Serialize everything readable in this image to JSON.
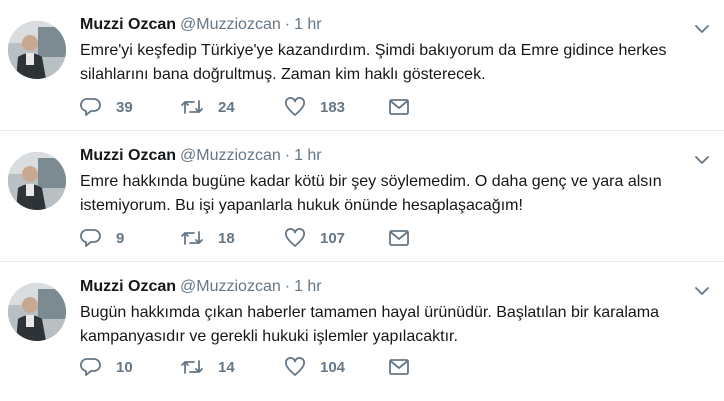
{
  "tweets": [
    {
      "name": "Muzzi Ozcan",
      "handle": "@Muzziozcan",
      "separator": "·",
      "time": "1 hr",
      "text": "Emre'yi keşfedip Türkiye'ye kazandırdım. Şimdi bakıyorum da Emre gidince herkes silahlarını bana doğrultmuş. Zaman kim haklı gösterecek.",
      "replies": "39",
      "retweets": "24",
      "likes": "183"
    },
    {
      "name": "Muzzi Ozcan",
      "handle": "@Muzziozcan",
      "separator": "·",
      "time": "1 hr",
      "text": "Emre hakkında bugüne kadar kötü bir şey söylemedim. O daha genç  ve yara alsın istemiyorum. Bu işi yapanlarla hukuk önünde hesaplaşacağım!",
      "replies": "9",
      "retweets": "18",
      "likes": "107"
    },
    {
      "name": "Muzzi Ozcan",
      "handle": "@Muzziozcan",
      "separator": "·",
      "time": "1 hr",
      "text": "Bugün hakkımda çıkan haberler tamamen hayal ürünüdür. Başlatılan bir karalama kampanyasıdır ve gerekli hukuki işlemler yapılacaktır.",
      "replies": "10",
      "retweets": "14",
      "likes": "104"
    }
  ],
  "icons": {
    "reply": "reply-icon",
    "retweet": "retweet-icon",
    "like": "heart-icon",
    "dm": "envelope-icon",
    "menu": "chevron-down-icon"
  },
  "colors": {
    "text": "#14171a",
    "secondary": "#657786",
    "divider": "#e6ecf0"
  }
}
